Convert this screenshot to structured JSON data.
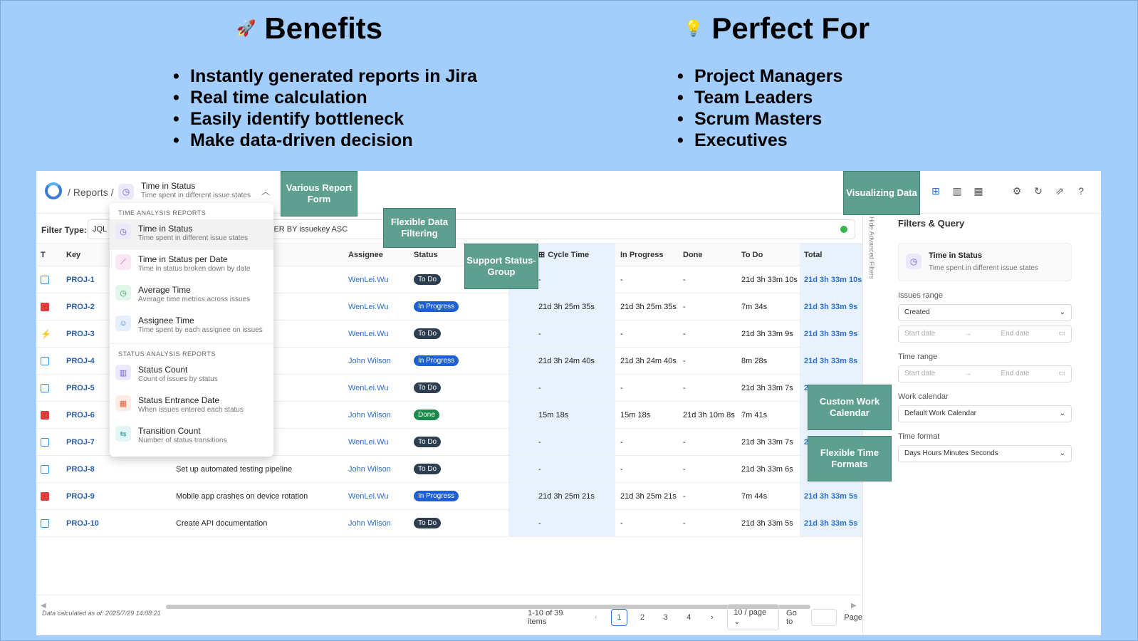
{
  "banner": {
    "benefits_title": "Benefits",
    "benefits": [
      "Instantly generated reports in Jira",
      "Real time calculation",
      "Easily identify bottleneck",
      "Make data-driven decision"
    ],
    "perfect_title": "Perfect For",
    "perfect": [
      "Project Managers",
      "Team Leaders",
      "Scrum Masters",
      "Executives"
    ]
  },
  "header": {
    "breadcrumb": "/ Reports /",
    "report_title": "Time in Status",
    "report_subtitle": "Time spent in different issue states"
  },
  "filter": {
    "label": "Filter Type:",
    "type": "JQL",
    "query": "ORDER BY issuekey ASC"
  },
  "columns": [
    "T",
    "Key",
    "Assignee",
    "Status",
    "Cycle Time",
    "In Progress",
    "Done",
    "To Do",
    "Total"
  ],
  "rows": [
    {
      "type": "task",
      "key": "PROJ-1",
      "summary": "n system",
      "assignee": "WenLei.Wu",
      "status": "To Do",
      "status_kind": "todo",
      "cycle": "-",
      "inprog": "-",
      "done": "-",
      "todo": "21d 3h 33m 10s",
      "total": "21d 3h 33m 10s"
    },
    {
      "type": "bug",
      "key": "PROJ-2",
      "summary": "essing module",
      "assignee": "WenLei.Wu",
      "status": "In Progress",
      "status_kind": "prog",
      "cycle": "21d 3h 25m 35s",
      "inprog": "21d 3h 25m 35s",
      "done": "-",
      "todo": "7m 34s",
      "total": "21d 3h 33m 9s"
    },
    {
      "type": "story",
      "key": "PROJ-3",
      "summary": "rience",
      "assignee": "WenLei.Wu",
      "status": "To Do",
      "status_kind": "todo",
      "cycle": "-",
      "inprog": "-",
      "done": "-",
      "todo": "21d 3h 33m 9s",
      "total": "21d 3h 33m 9s"
    },
    {
      "type": "task",
      "key": "PROJ-4",
      "summary": "formance",
      "assignee": "John Wilson",
      "status": "In Progress",
      "status_kind": "prog",
      "cycle": "21d 3h 24m 40s",
      "inprog": "21d 3h 24m 40s",
      "done": "-",
      "todo": "8m 28s",
      "total": "21d 3h 33m 8s"
    },
    {
      "type": "task",
      "key": "PROJ-5",
      "summary": "eports",
      "assignee": "WenLei.Wu",
      "status": "To Do",
      "status_kind": "todo",
      "cycle": "-",
      "inprog": "-",
      "done": "-",
      "todo": "21d 3h 33m 7s",
      "total": "21"
    },
    {
      "type": "bug",
      "key": "PROJ-6",
      "summary": "ross different pa...",
      "assignee": "John Wilson",
      "status": "Done",
      "status_kind": "done",
      "cycle": "15m 18s",
      "inprog": "15m 18s",
      "done": "21d 3h 10m 8s",
      "todo": "7m 41s",
      "total": ""
    },
    {
      "type": "task",
      "key": "PROJ-7",
      "summary": "ions",
      "assignee": "WenLei.Wu",
      "status": "To Do",
      "status_kind": "todo",
      "cycle": "-",
      "inprog": "-",
      "done": "-",
      "todo": "21d 3h 33m 7s",
      "total": "21"
    },
    {
      "type": "task",
      "key": "PROJ-8",
      "summary": "Set up automated testing pipeline",
      "assignee": "John Wilson",
      "status": "To Do",
      "status_kind": "todo",
      "cycle": "-",
      "inprog": "-",
      "done": "-",
      "todo": "21d 3h 33m 6s",
      "total": ""
    },
    {
      "type": "bug",
      "key": "PROJ-9",
      "summary": "Mobile app crashes on device rotation",
      "assignee": "WenLei.Wu",
      "status": "In Progress",
      "status_kind": "prog",
      "cycle": "21d 3h 25m 21s",
      "inprog": "21d 3h 25m 21s",
      "done": "-",
      "todo": "7m 44s",
      "total": "21d 3h 33m 5s"
    },
    {
      "type": "task",
      "key": "PROJ-10",
      "summary": "Create API documentation",
      "assignee": "John Wilson",
      "status": "To Do",
      "status_kind": "todo",
      "cycle": "-",
      "inprog": "-",
      "done": "-",
      "todo": "21d 3h 33m 5s",
      "total": "21d 3h 33m 5s"
    }
  ],
  "dropdown": {
    "section1": "TIME ANALYSIS REPORTS",
    "items1": [
      {
        "title": "Time in Status",
        "sub": "Time spent in different issue states",
        "icon": "clock-icon",
        "bg": "#ece9fb",
        "fg": "#6b5bd6"
      },
      {
        "title": "Time in Status per Date",
        "sub": "Time in status broken down by date",
        "icon": "line-chart-icon",
        "bg": "#fbe6f3",
        "fg": "#d04aa0"
      },
      {
        "title": "Average Time",
        "sub": "Average time metrics across issues",
        "icon": "clock-icon",
        "bg": "#e3f6ea",
        "fg": "#2f9e5a"
      },
      {
        "title": "Assignee Time",
        "sub": "Time spent by each assignee on issues",
        "icon": "user-icon",
        "bg": "#e6f0fd",
        "fg": "#3a7bd5"
      }
    ],
    "section2": "STATUS ANALYSIS REPORTS",
    "items2": [
      {
        "title": "Status Count",
        "sub": "Count of issues by status",
        "icon": "bar-chart-icon",
        "bg": "#ece9fb",
        "fg": "#6b5bd6"
      },
      {
        "title": "Status Entrance Date",
        "sub": "When issues entered each status",
        "icon": "calendar-icon",
        "bg": "#fdebe6",
        "fg": "#e0603a"
      },
      {
        "title": "Transition Count",
        "sub": "Number of status transitions",
        "icon": "arrows-icon",
        "bg": "#e3f6f6",
        "fg": "#2aa0a0"
      }
    ]
  },
  "callouts": {
    "report_form": "Various Report Form",
    "filtering": "Flexible Data Filtering",
    "status_group": "Support Status-Group",
    "visualizing": "Visualizing Data",
    "calendar": "Custom Work Calendar",
    "time_formats": "Flexible Time Formats"
  },
  "panel": {
    "title": "Filters & Query",
    "card_title": "Time in Status",
    "card_sub": "Time spent in different issue states",
    "issues_range_label": "Issues range",
    "issues_range": "Created",
    "start_date": "Start date",
    "end_date": "End date",
    "time_range_label": "Time range",
    "work_calendar_label": "Work calendar",
    "work_calendar": "Default Work Calendar",
    "time_format_label": "Time format",
    "time_format": "Days Hours Minutes Seconds",
    "hide_filters": "Hide Advanced Filters"
  },
  "footer": {
    "calculated": "Data calculated as of: 2025/7/29 14:08:21",
    "range": "1-10 of 39 items",
    "pages": [
      "1",
      "2",
      "3",
      "4"
    ],
    "page_size": "10 / page",
    "goto": "Go to",
    "page": "Page"
  }
}
